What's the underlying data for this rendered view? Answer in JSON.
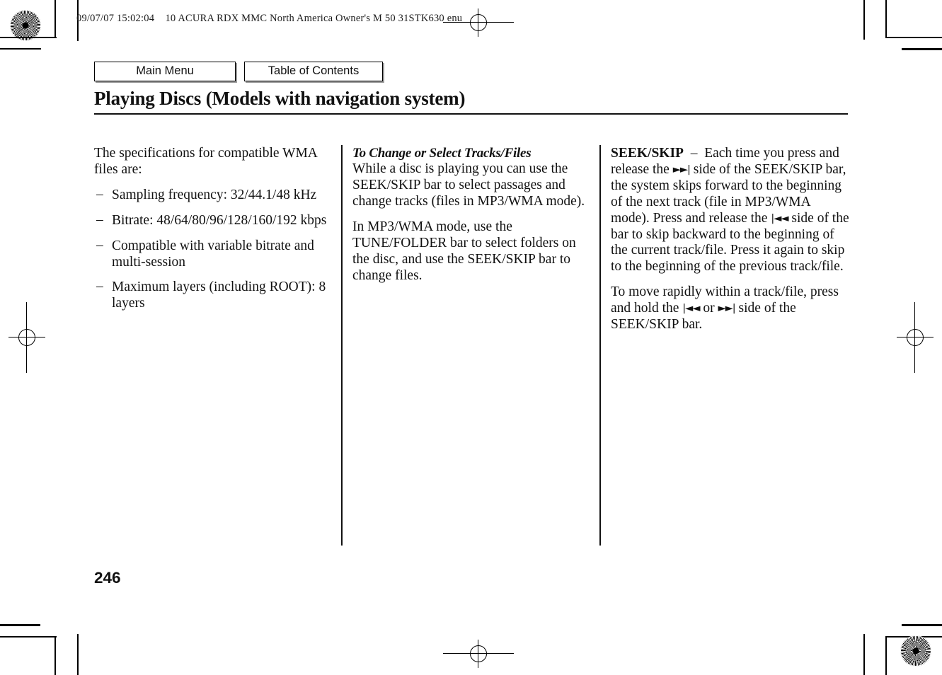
{
  "header": {
    "meta_line": "09/07/07 15:02:04    10 ACURA RDX MMC North America Owner's M 50 31STK630 enu"
  },
  "nav": {
    "main_menu_label": "Main Menu",
    "table_of_contents_label": "Table of Contents"
  },
  "title": "Playing Discs (Models with navigation system)",
  "columns": {
    "col1": {
      "intro": "The specifications for compatible WMA files are:",
      "bullets": [
        "Sampling frequency: 32/44.1/48 kHz",
        "Bitrate: 48/64/80/96/128/160/192 kbps",
        "Compatible with variable bitrate and multi-session",
        "Maximum layers (including ROOT): 8 layers"
      ],
      "bullet_marker": "–"
    },
    "col2": {
      "heading": "To Change or Select Tracks/Files",
      "para1": "While a disc is playing you can use the SEEK/SKIP bar to select passages and change tracks (files in MP3/WMA mode).",
      "para2": "In MP3/WMA mode, use the TUNE/FOLDER bar to select folders on the disc, and use the SEEK/SKIP bar to change files."
    },
    "col3": {
      "term": "SEEK/SKIP",
      "dash": "–",
      "para1_a": "Each time you press and release the",
      "glyph_forward": "►►|",
      "para1_b": "side of the SEEK/SKIP bar, the system skips forward to the beginning of the next track (file in MP3/WMA mode). Press and release the",
      "glyph_back": "|◄◄",
      "para1_c": "side of the bar to skip backward to the beginning of the current track/file. Press it again to skip to the beginning of the previous track/file.",
      "para2_a": "To move rapidly within a track/file, press and hold the",
      "para2_or": "or",
      "para2_b": "side of the SEEK/SKIP bar."
    }
  },
  "page_number": "246",
  "colors": {
    "text": "#111111",
    "rule": "#111111",
    "button_shadow": "#9a9a9a",
    "page_background": "#ffffff"
  }
}
